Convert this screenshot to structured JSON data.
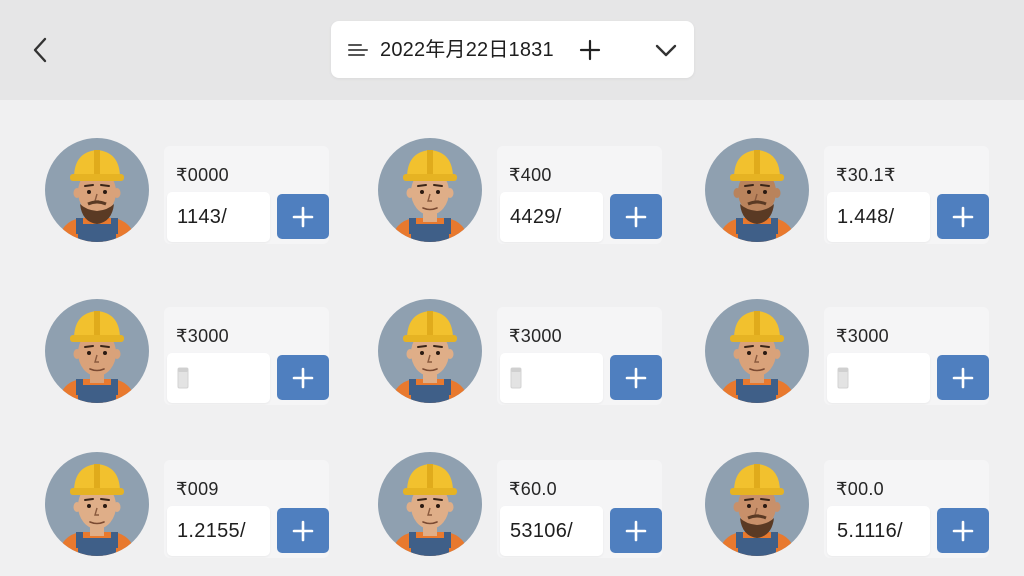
{
  "header": {
    "back_icon": "chevron-left-icon",
    "date_picker": {
      "menu_icon": "lines-icon",
      "date_text": "2022年月22日1831",
      "plus_icon": "plus-icon",
      "dropdown_icon": "chevron-down-icon"
    }
  },
  "colors": {
    "background": "#f0f0f1",
    "header": "#e6e6e7",
    "accent": "#4f7fbf",
    "helmet": "#f2c12e",
    "vest": "#e8792e",
    "overalls": "#3f5f88",
    "avatar_bg": "#8fa0b0"
  },
  "workers": [
    {
      "rate": "₹0000",
      "value": "1143/",
      "beard": true,
      "skin": "#d9a27a"
    },
    {
      "rate": "₹400",
      "value": "4429/",
      "beard": false,
      "skin": "#dfae88"
    },
    {
      "rate": "₹30.1₹",
      "value": "1.448/",
      "beard": true,
      "skin": "#b9835c"
    },
    {
      "rate": "₹3000",
      "value": "",
      "beard": false,
      "skin": "#d9a27a"
    },
    {
      "rate": "₹3000",
      "value": "",
      "beard": false,
      "skin": "#dfae88"
    },
    {
      "rate": "₹3000",
      "value": "",
      "beard": false,
      "skin": "#d9a27a"
    },
    {
      "rate": "₹009",
      "value": "1.2155/",
      "beard": false,
      "skin": "#dfae88"
    },
    {
      "rate": "₹60.0",
      "value": "53106/",
      "beard": false,
      "skin": "#dfae88"
    },
    {
      "rate": "₹00.0",
      "value": "5.1116/",
      "beard": true,
      "skin": "#c8906a"
    }
  ],
  "add_button_icon": "plus-icon",
  "empty_value_icon": "placeholder-icon"
}
